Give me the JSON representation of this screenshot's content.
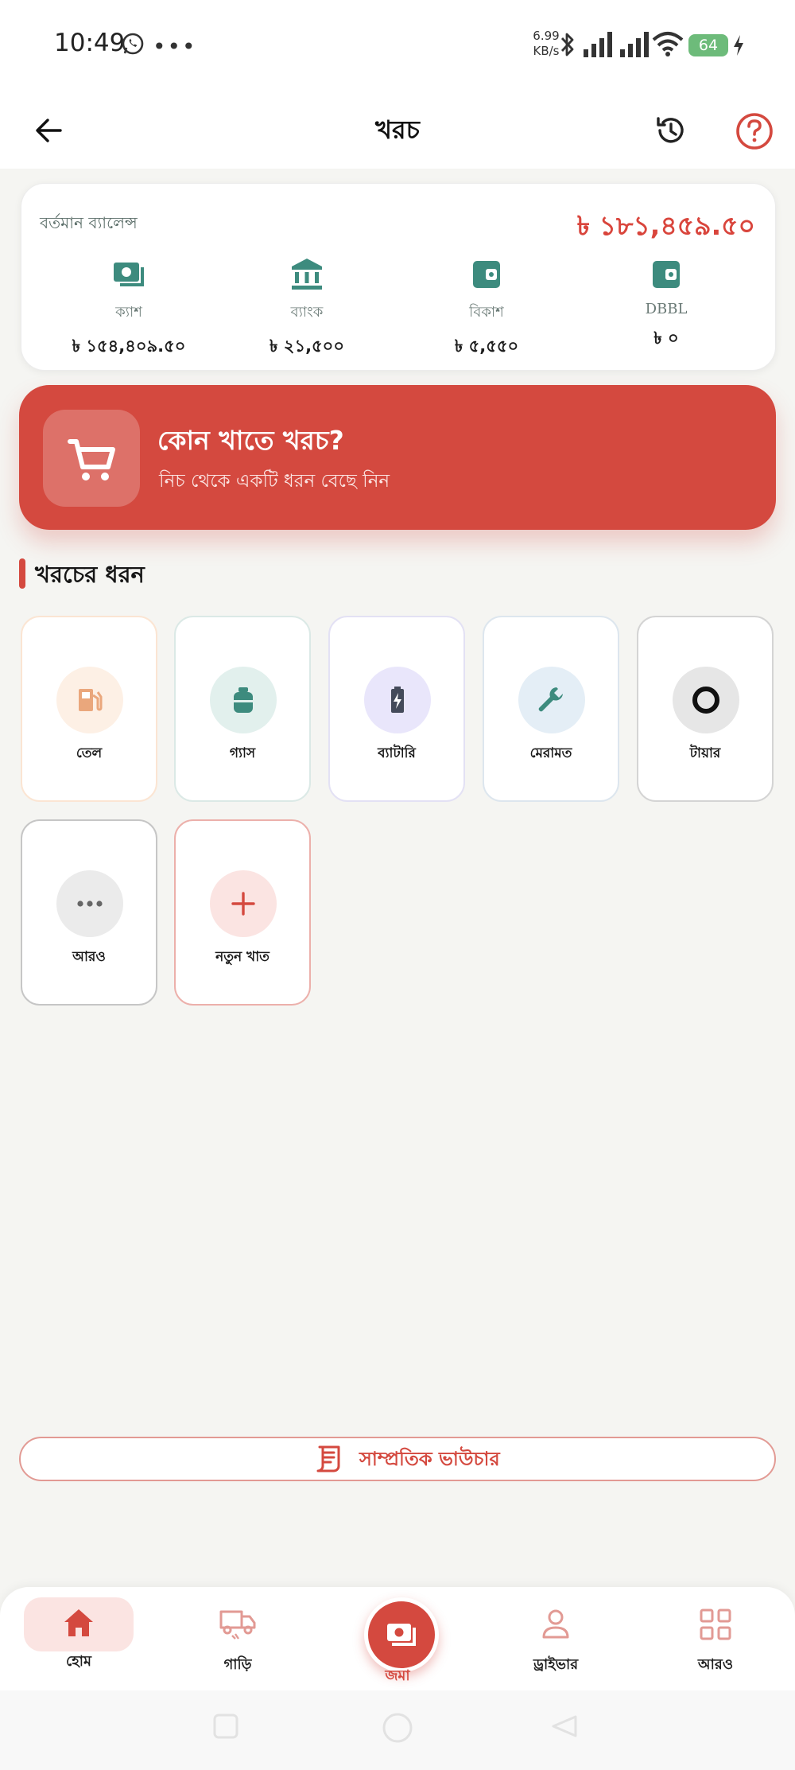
{
  "status_bar": {
    "time": "10:49",
    "net_speed_value": "6.99",
    "net_speed_unit": "KB/s",
    "battery": "64",
    "icons": [
      "whatsapp-icon",
      "more-dots-icon",
      "bluetooth-icon",
      "signal-icon",
      "signal-icon",
      "wifi-icon",
      "charging-icon"
    ]
  },
  "header": {
    "title": "খরচ",
    "back_icon": "arrow-left-icon",
    "history_icon": "history-icon",
    "help_icon": "help-circle-icon"
  },
  "balance": {
    "label": "বর্তমান ব্যালেন্স",
    "total": "৳ ১৮১,৪৫৯.৫০",
    "accounts": [
      {
        "name": "ক্যাশ",
        "value": "৳ ১৫৪,৪০৯.৫০",
        "icon": "cash-icon"
      },
      {
        "name": "ব্যাংক",
        "value": "৳ ২১,৫০০",
        "icon": "bank-icon"
      },
      {
        "name": "বিকাশ",
        "value": "৳ ৫,৫৫০",
        "icon": "wallet-icon"
      },
      {
        "name": "DBBL",
        "value": "৳ ০",
        "icon": "wallet-icon"
      }
    ]
  },
  "banner": {
    "title": "কোন খাতে খরচ?",
    "subtitle": "নিচ থেকে একটি ধরন বেছে নিন",
    "icon": "cart-icon"
  },
  "section": {
    "title": "খরচের ধরন"
  },
  "categories": [
    {
      "label": "তেল",
      "icon": "fuel-icon"
    },
    {
      "label": "গ্যাস",
      "icon": "gas-cylinder-icon"
    },
    {
      "label": "ব্যাটারি",
      "icon": "battery-icon"
    },
    {
      "label": "মেরামত",
      "icon": "wrench-icon"
    },
    {
      "label": "টায়ার",
      "icon": "tire-icon"
    },
    {
      "label": "আরও",
      "icon": "more-icon"
    },
    {
      "label": "নতুন খাত",
      "icon": "plus-icon"
    }
  ],
  "voucher": {
    "label": "সাম্প্রতিক ভাউচার",
    "icon": "receipt-icon"
  },
  "bottom_nav": [
    {
      "label": "হোম",
      "icon": "home-icon",
      "active": true
    },
    {
      "label": "গাড়ি",
      "icon": "truck-icon"
    },
    {
      "label": "জমা",
      "icon": "cash-icon"
    },
    {
      "label": "ড্রাইভার",
      "icon": "user-icon"
    },
    {
      "label": "আরও",
      "icon": "grid-icon"
    }
  ],
  "colors": {
    "accent": "#d4493f",
    "teal": "#3d8b7e",
    "background": "#f5f5f2"
  }
}
